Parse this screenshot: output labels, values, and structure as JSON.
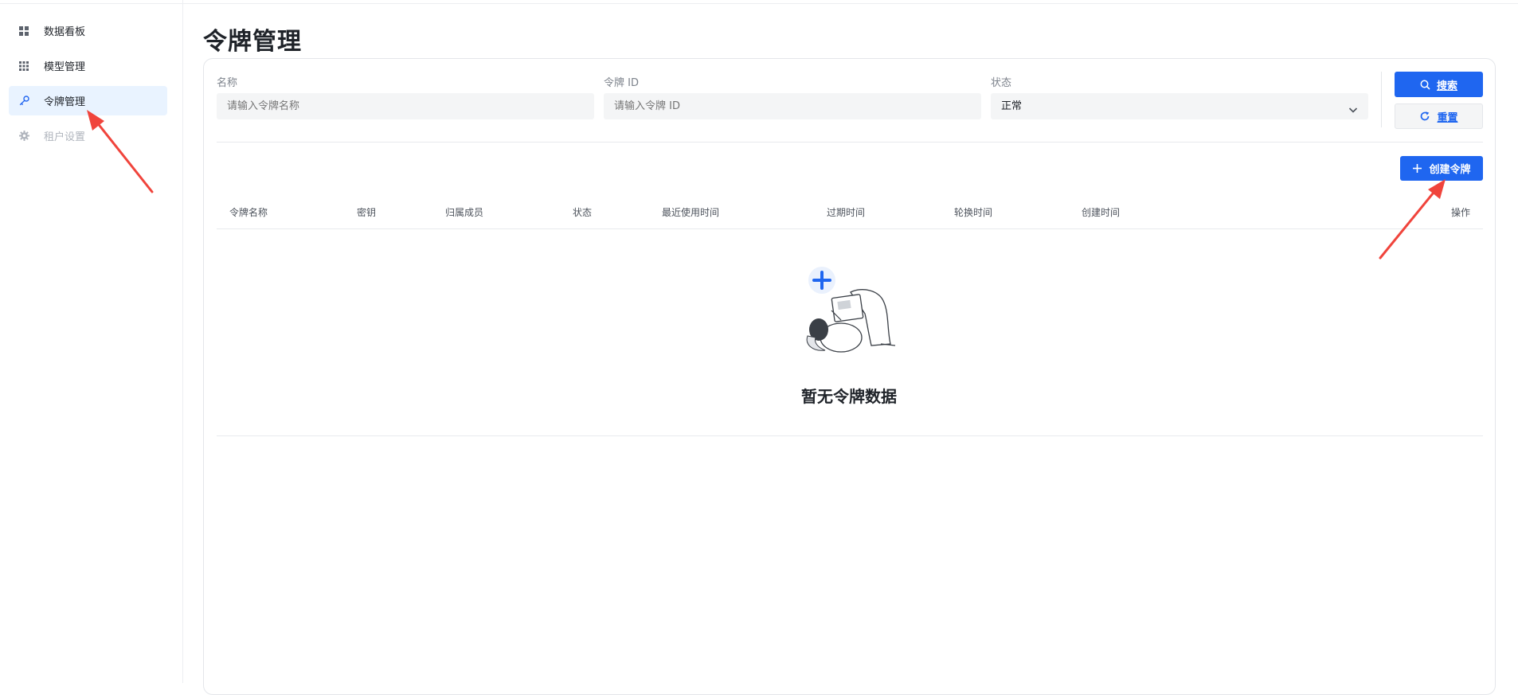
{
  "sidebar": {
    "items": [
      {
        "label": "数据看板",
        "icon": "dashboard-grid-icon",
        "state": "normal"
      },
      {
        "label": "模型管理",
        "icon": "apps-grid-icon",
        "state": "normal"
      },
      {
        "label": "令牌管理",
        "icon": "key-icon",
        "state": "active"
      },
      {
        "label": "租户设置",
        "icon": "gear-icon",
        "state": "disabled"
      }
    ]
  },
  "page": {
    "title": "令牌管理"
  },
  "filters": {
    "name": {
      "label": "名称",
      "placeholder": "请输入令牌名称"
    },
    "token_id": {
      "label": "令牌 ID",
      "placeholder": "请输入令牌 ID"
    },
    "status": {
      "label": "状态",
      "value": "正常"
    }
  },
  "actions": {
    "search_label": "搜索",
    "reset_label": "重置",
    "create_label": "创建令牌"
  },
  "table": {
    "columns": [
      "令牌名称",
      "密钥",
      "归属成员",
      "状态",
      "最近使用时间",
      "过期时间",
      "轮换时间",
      "创建时间",
      "操作"
    ],
    "rows": [],
    "empty_text": "暂无令牌数据"
  },
  "colors": {
    "accent": "#1f66f0",
    "active_bg": "#e9f3ff",
    "annotation_arrow": "#f0443c"
  }
}
